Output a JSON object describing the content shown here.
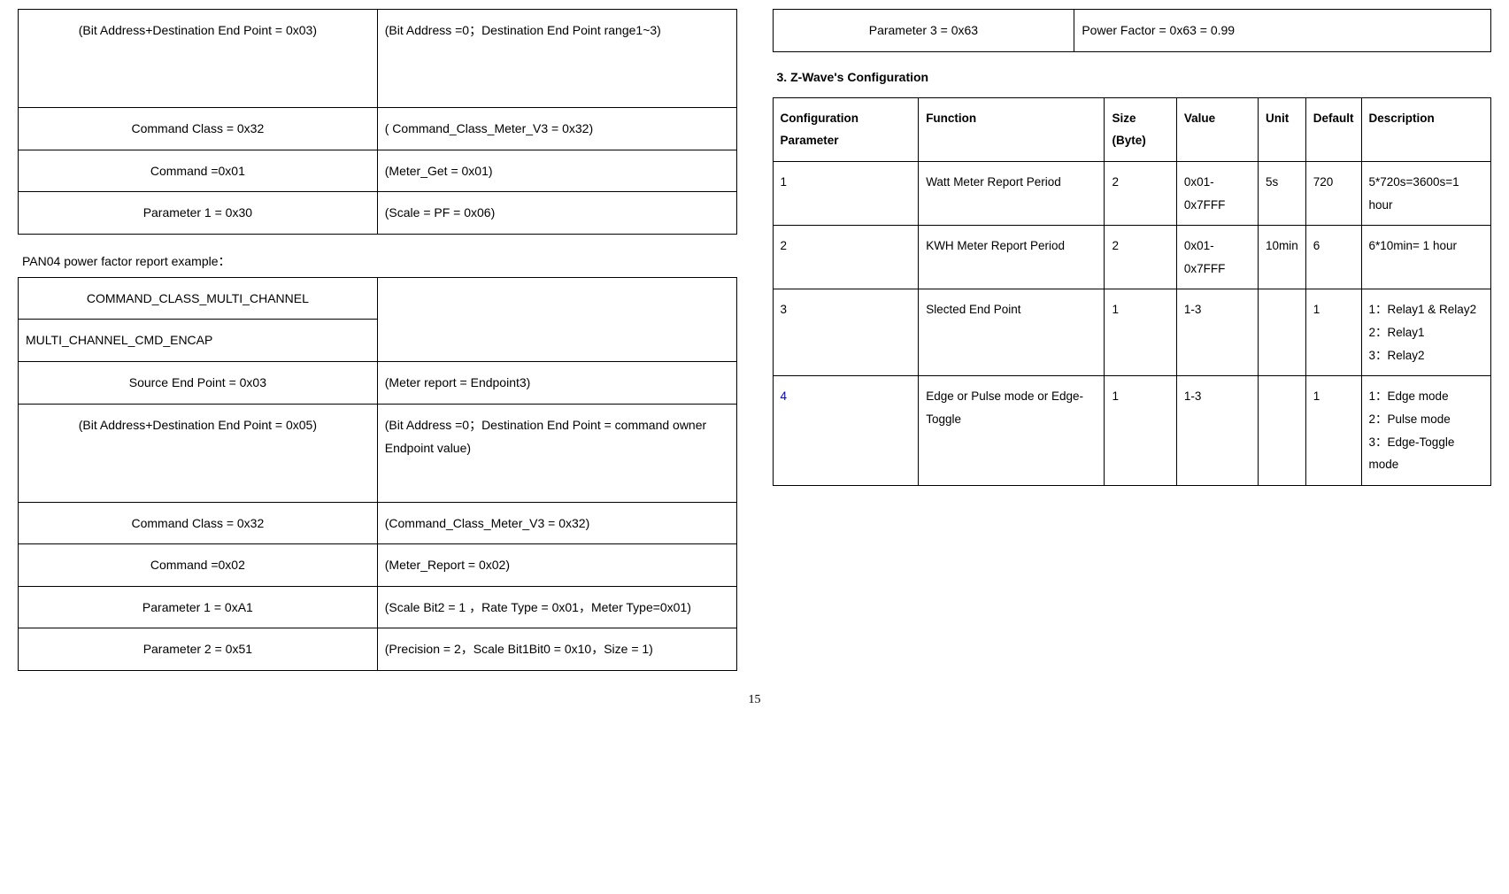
{
  "leftTop": {
    "r1c1": "(Bit Address+Destination End Point = 0x03)",
    "r1c2": "(Bit Address =0；Destination End Point range1~3)",
    "r2c1": "Command Class = 0x32",
    "r2c2": "( Command_Class_Meter_V3 = 0x32)",
    "r3c1": "Command =0x01",
    "r3c2": "(Meter_Get = 0x01)",
    "r4c1": "Parameter 1 = 0x30",
    "r4c2": "(Scale = PF = 0x06)"
  },
  "caption1": "PAN04 power factor report example：",
  "leftBottom": {
    "r1c1": "COMMAND_CLASS_MULTI_CHANNEL",
    "r1c2": "",
    "r2c1": "MULTI_CHANNEL_CMD_ENCAP",
    "r2c2": "",
    "r3c1": "Source End Point = 0x03",
    "r3c2": "(Meter report = Endpoint3)",
    "r4c1": "(Bit Address+Destination End Point = 0x05)",
    "r4c2": "(Bit Address =0；Destination End Point = command owner Endpoint value)",
    "r5c1": "Command Class = 0x32",
    "r5c2": "(Command_Class_Meter_V3 = 0x32)",
    "r6c1": "Command =0x02",
    "r6c2": "(Meter_Report = 0x02)",
    "r7c1": "Parameter 1 = 0xA1",
    "r7c2": "(Scale Bit2 = 1 ，Rate Type = 0x01，Meter Type=0x01)",
    "r8c1": "Parameter 2 = 0x51",
    "r8c2": "(Precision = 2，Scale Bit1Bit0 = 0x10，Size = 1)"
  },
  "rightTop": {
    "c1": "Parameter 3 = 0x63",
    "c2": "Power Factor = 0x63 = 0.99"
  },
  "sectionTitle": "3.   Z-Wave's Configuration",
  "conf": {
    "h1": "Configuration Parameter",
    "h2": "Function",
    "h3": "Size (Byte)",
    "h4": "Value",
    "h5": "Unit",
    "h6": "Default",
    "h7": "Description",
    "rows": [
      {
        "p": "1",
        "f": "Watt Meter Report Period",
        "s": "2",
        "v": "0x01-0x7FFF",
        "u": "5s",
        "d": "720",
        "desc": "5*720s=3600s=1 hour"
      },
      {
        "p": "2",
        "f": "KWH Meter Report Period",
        "s": "2",
        "v": "0x01-0x7FFF",
        "u": "10min",
        "d": "6",
        "desc": "6*10min= 1 hour"
      },
      {
        "p": "3",
        "f": "Slected End Point",
        "s": "1",
        "v": "1-3",
        "u": "",
        "d": "1",
        "desc": "1：Relay1 & Relay2\n2：Relay1\n3：Relay2"
      },
      {
        "p": "4",
        "f": "Edge or Pulse mode or Edge-Toggle",
        "s": "1",
        "v": "1-3",
        "u": "",
        "d": "1",
        "desc": "1：Edge mode\n2：Pulse mode\n3：Edge-Toggle mode"
      }
    ]
  },
  "pagenum": "15"
}
